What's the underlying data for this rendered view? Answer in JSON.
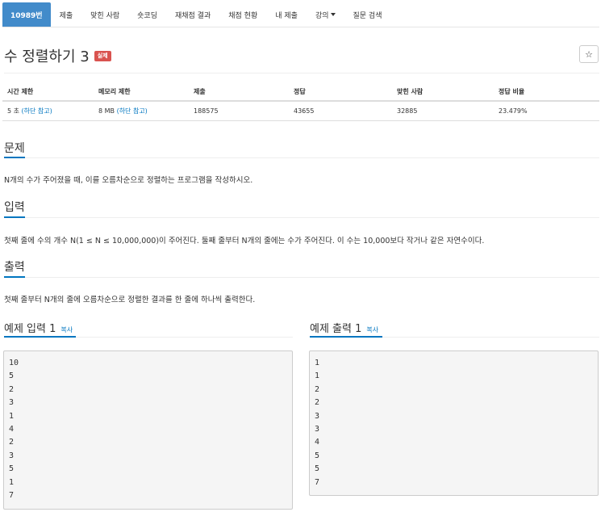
{
  "nav": {
    "tabs": [
      "10989번",
      "제출",
      "맞힌 사람",
      "숏코딩",
      "재채점 결과",
      "채점 현황",
      "내 제출",
      "강의",
      "질문 검색"
    ],
    "active_index": 0
  },
  "problem": {
    "title": "수 정렬하기 3",
    "badge": "실제",
    "star": "☆"
  },
  "stats": {
    "headers": [
      "시간 제한",
      "메모리 제한",
      "제출",
      "정답",
      "맞힌 사람",
      "정답 비율"
    ],
    "time_limit": "5 초 ",
    "time_note": "(하단 참고)",
    "memory_limit": "8 MB ",
    "memory_note": "(하단 참고)",
    "submissions": "188575",
    "accepted": "43655",
    "solvers": "32885",
    "ratio": "23.479%"
  },
  "sections": {
    "problem_heading": "문제",
    "problem_text": "N개의 수가 주어졌을 때, 이를 오름차순으로 정렬하는 프로그램을 작성하시오.",
    "input_heading": "입력",
    "input_text": "첫째 줄에 수의 개수 N(1 ≤ N ≤ 10,000,000)이 주어진다. 둘째 줄부터 N개의 줄에는 수가 주어진다. 이 수는 10,000보다 작거나 같은 자연수이다.",
    "output_heading": "출력",
    "output_text": "첫째 줄부터 N개의 줄에 오름차순으로 정렬한 결과를 한 줄에 하나씩 출력한다."
  },
  "examples": {
    "input_title": "예제 입력 1",
    "output_title": "예제 출력 1",
    "copy_label": "복사",
    "input_lines": [
      "10",
      "5",
      "2",
      "3",
      "1",
      "4",
      "2",
      "3",
      "5",
      "1",
      "7"
    ],
    "output_lines": [
      "1",
      "1",
      "2",
      "2",
      "3",
      "3",
      "4",
      "5",
      "5",
      "7"
    ]
  },
  "colors": {
    "active_tab": "#428bca",
    "badge": "#d9534f",
    "link": "#0076c0"
  }
}
